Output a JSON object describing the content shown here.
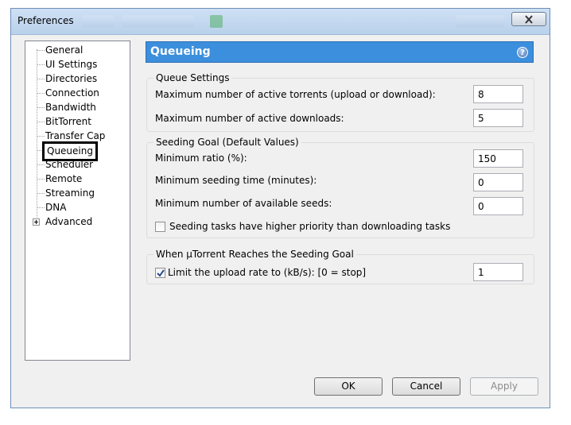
{
  "window": {
    "title": "Preferences"
  },
  "sidebar": {
    "items": [
      {
        "label": "General"
      },
      {
        "label": "UI Settings"
      },
      {
        "label": "Directories"
      },
      {
        "label": "Connection"
      },
      {
        "label": "Bandwidth"
      },
      {
        "label": "BitTorrent"
      },
      {
        "label": "Transfer Cap"
      },
      {
        "label": "Queueing",
        "selected": true
      },
      {
        "label": "Scheduler"
      },
      {
        "label": "Remote"
      },
      {
        "label": "Streaming"
      },
      {
        "label": "DNA"
      },
      {
        "label": "Advanced",
        "expandable": true
      }
    ]
  },
  "panel": {
    "title": "Queueing",
    "header_color": "#3c8fdc",
    "queue_settings": {
      "title": "Queue Settings",
      "max_active_torrents_label": "Maximum number of active torrents (upload or download):",
      "max_active_torrents_value": "8",
      "max_active_downloads_label": "Maximum number of active downloads:",
      "max_active_downloads_value": "5"
    },
    "seeding_goal": {
      "title": "Seeding Goal (Default Values)",
      "min_ratio_label": "Minimum ratio (%):",
      "min_ratio_value": "150",
      "min_seeding_time_label": "Minimum seeding time (minutes):",
      "min_seeding_time_value": "0",
      "min_seeds_label": "Minimum number of available seeds:",
      "min_seeds_value": "0",
      "priority_checkbox_label": "Seeding tasks have higher priority than downloading tasks",
      "priority_checked": false
    },
    "reaches_goal": {
      "title": "When µTorrent Reaches the Seeding Goal",
      "limit_checkbox_label": "Limit the upload rate to (kB/s): [0 = stop]",
      "limit_checked": true,
      "limit_value": "1"
    }
  },
  "buttons": {
    "ok": "OK",
    "cancel": "Cancel",
    "apply": "Apply"
  }
}
